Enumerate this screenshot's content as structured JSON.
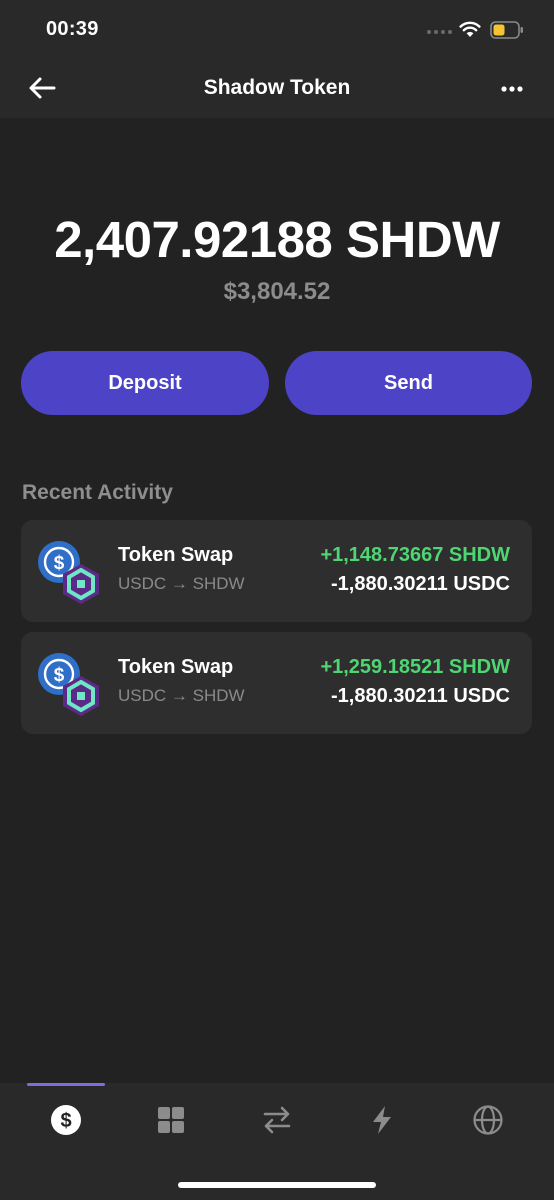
{
  "status_bar": {
    "time": "00:39"
  },
  "header": {
    "title": "Shadow Token"
  },
  "balance": {
    "amount": "2,407.92188 SHDW",
    "fiat": "$3,804.52"
  },
  "actions": {
    "deposit_label": "Deposit",
    "send_label": "Send"
  },
  "recent_activity": {
    "title": "Recent Activity",
    "items": [
      {
        "title": "Token Swap",
        "subtitle": "USDC → SHDW",
        "amount_in": "+1,148.73667 SHDW",
        "amount_out": "-1,880.30211 USDC"
      },
      {
        "title": "Token Swap",
        "subtitle": "USDC → SHDW",
        "amount_in": "+1,259.18521 SHDW",
        "amount_out": "-1,880.30211 USDC"
      }
    ]
  },
  "tab_bar": {
    "tabs": [
      {
        "icon": "dollar-icon",
        "active": true
      },
      {
        "icon": "grid-icon",
        "active": false
      },
      {
        "icon": "swap-arrows-icon",
        "active": false
      },
      {
        "icon": "lightning-icon",
        "active": false
      },
      {
        "icon": "globe-icon",
        "active": false
      }
    ]
  },
  "colors": {
    "accent": "#4c43c6",
    "positive": "#4ed672",
    "background": "#222222",
    "card": "#2e2e2e",
    "tab_indicator": "#7a6ee0"
  }
}
